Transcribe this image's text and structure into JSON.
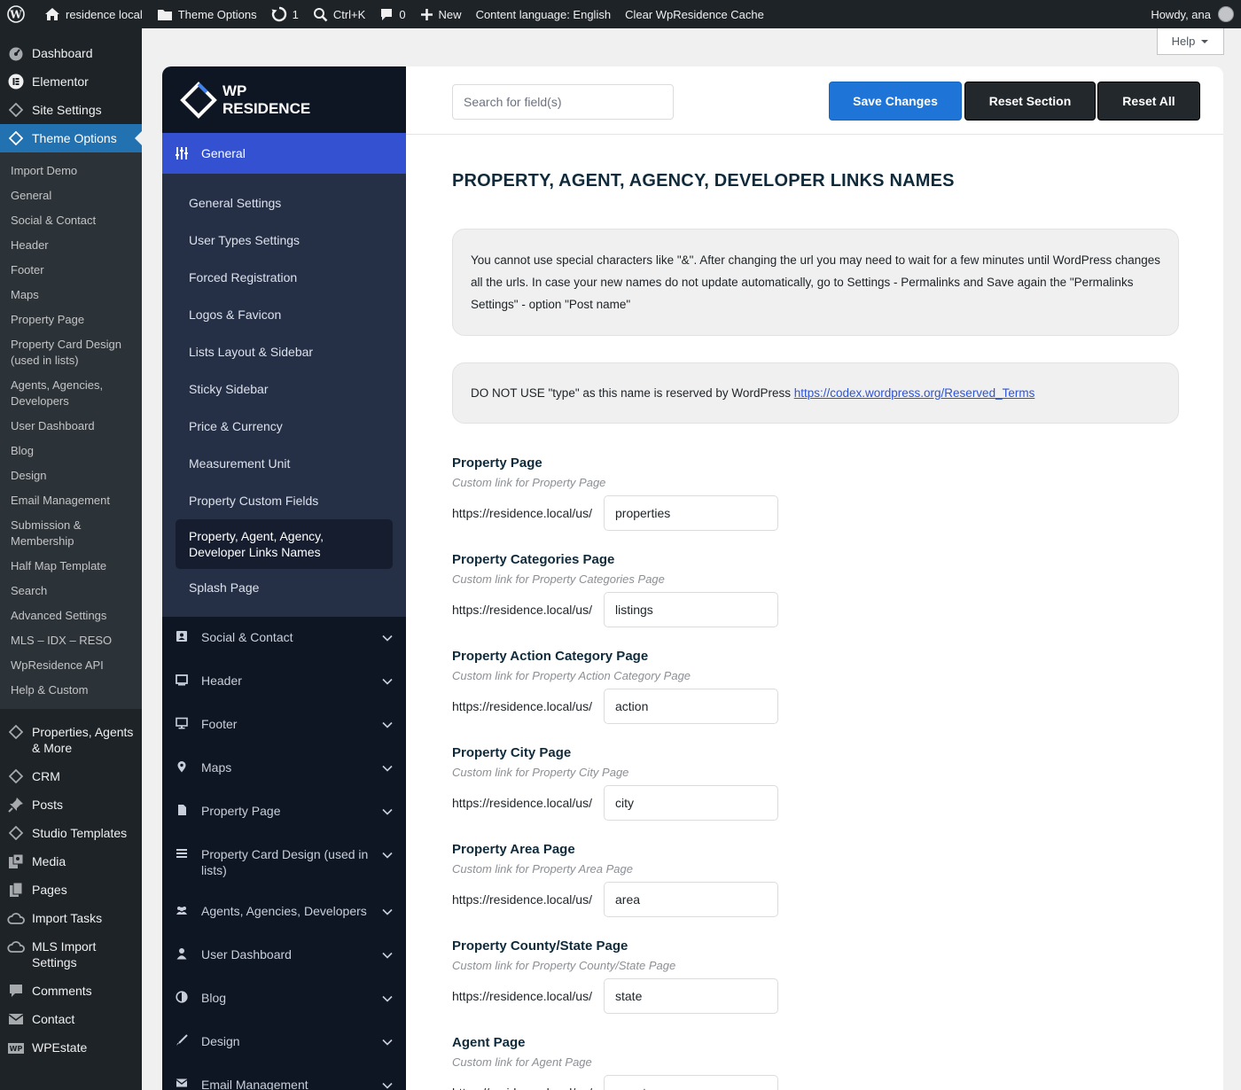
{
  "adminbar": {
    "site_name": "residence local",
    "theme_options": "Theme Options",
    "updates": "1",
    "shortcut": "Ctrl+K",
    "comments": "0",
    "new": "New",
    "content_language": "Content language: English",
    "clear_cache": "Clear WpResidence Cache",
    "howdy": "Howdy, ana"
  },
  "wp_menu": {
    "top_before": [
      {
        "label": "Dashboard",
        "icon": "dashboard-icon"
      },
      {
        "label": "Elementor",
        "icon": "elementor-icon"
      },
      {
        "label": "Site Settings",
        "icon": "diamond-icon"
      }
    ],
    "current": {
      "label": "Theme Options",
      "icon": "diamond-icon"
    },
    "submenu": [
      "Import Demo",
      "General",
      "Social & Contact",
      "Header",
      "Footer",
      "Maps",
      "Property Page",
      "Property Card Design (used in lists)",
      "Agents, Agencies, Developers",
      "User Dashboard",
      "Blog",
      "Design",
      "Email Management",
      "Submission & Membership",
      "Half Map Template",
      "Search",
      "Advanced Settings",
      "MLS – IDX – RESO",
      "WpResidence API",
      "Help & Custom"
    ],
    "top_after": [
      {
        "label": "Properties, Agents & More",
        "icon": "diamond-icon"
      },
      {
        "label": "CRM",
        "icon": "diamond-icon"
      },
      {
        "label": "Posts",
        "icon": "pin-icon"
      },
      {
        "label": "Studio Templates",
        "icon": "diamond-icon"
      },
      {
        "label": "Media",
        "icon": "media-icon"
      },
      {
        "label": "Pages",
        "icon": "pages-icon"
      },
      {
        "label": "Import Tasks",
        "icon": "cloud-icon"
      },
      {
        "label": "MLS Import Settings",
        "icon": "cloud-icon"
      },
      {
        "label": "Comments",
        "icon": "comment-icon"
      },
      {
        "label": "Contact",
        "icon": "mail-icon"
      },
      {
        "label": "WPEstate",
        "icon": "wpestate-icon"
      }
    ]
  },
  "help": "Help",
  "brand": {
    "line1": "WP",
    "line2": "RESIDENCE"
  },
  "options_nav": {
    "active_section": "General",
    "subsections": [
      "General Settings",
      "User Types Settings",
      "Forced Registration",
      "Logos & Favicon",
      "Lists Layout & Sidebar",
      "Sticky Sidebar",
      "Price & Currency",
      "Measurement Unit",
      "Property Custom Fields",
      "Property, Agent, Agency, Developer Links Names",
      "Splash Page"
    ],
    "active_subsection_index": 9,
    "sections": [
      {
        "label": "Social & Contact",
        "icon": "contact-card-icon"
      },
      {
        "label": "Header",
        "icon": "monitor-icon"
      },
      {
        "label": "Footer",
        "icon": "desktop-icon"
      },
      {
        "label": "Maps",
        "icon": "map-pin-icon"
      },
      {
        "label": "Property Page",
        "icon": "page-icon"
      },
      {
        "label": "Property Card Design (used in lists)",
        "icon": "list-icon"
      },
      {
        "label": "Agents, Agencies, Developers",
        "icon": "users-icon"
      },
      {
        "label": "User Dashboard",
        "icon": "user-icon"
      },
      {
        "label": "Blog",
        "icon": "contrast-icon"
      },
      {
        "label": "Design",
        "icon": "brush-icon"
      },
      {
        "label": "Email Management",
        "icon": "envelope-icon"
      }
    ]
  },
  "toolbar": {
    "search_placeholder": "Search for field(s)",
    "save": "Save Changes",
    "reset_section": "Reset Section",
    "reset_all": "Reset All"
  },
  "content": {
    "title": "PROPERTY, AGENT, AGENCY, DEVELOPER LINKS NAMES",
    "notice1": "You cannot use special characters like \"&\". After changing the url you may need to wait for a few minutes until WordPress changes all the urls. In case your new names do not update automatically, go to Settings - Permalinks and Save again the \"Permalinks Settings\" - option \"Post name\"",
    "notice2_text": "DO NOT USE \"type\" as this name is reserved by WordPress ",
    "notice2_link": "https://codex.wordpress.org/Reserved_Terms",
    "prefix": "https://residence.local/us/",
    "fields": [
      {
        "title": "Property Page",
        "subtitle": "Custom link for Property Page",
        "value": "properties"
      },
      {
        "title": "Property Categories Page",
        "subtitle": "Custom link for Property Categories Page",
        "value": "listings"
      },
      {
        "title": "Property Action Category Page",
        "subtitle": "Custom link for Property Action Category Page",
        "value": "action"
      },
      {
        "title": "Property City Page",
        "subtitle": "Custom link for Property City Page",
        "value": "city"
      },
      {
        "title": "Property Area Page",
        "subtitle": "Custom link for Property Area Page",
        "value": "area"
      },
      {
        "title": "Property County/State Page",
        "subtitle": "Custom link for Property County/State Page",
        "value": "state"
      },
      {
        "title": "Agent Page",
        "subtitle": "Custom link for Agent Page",
        "value": "agents"
      }
    ]
  },
  "colors": {
    "accent": "#2271b1",
    "panel_dark": "#0f1623",
    "active_section": "#3451d1",
    "save_button": "#1e74d7"
  }
}
